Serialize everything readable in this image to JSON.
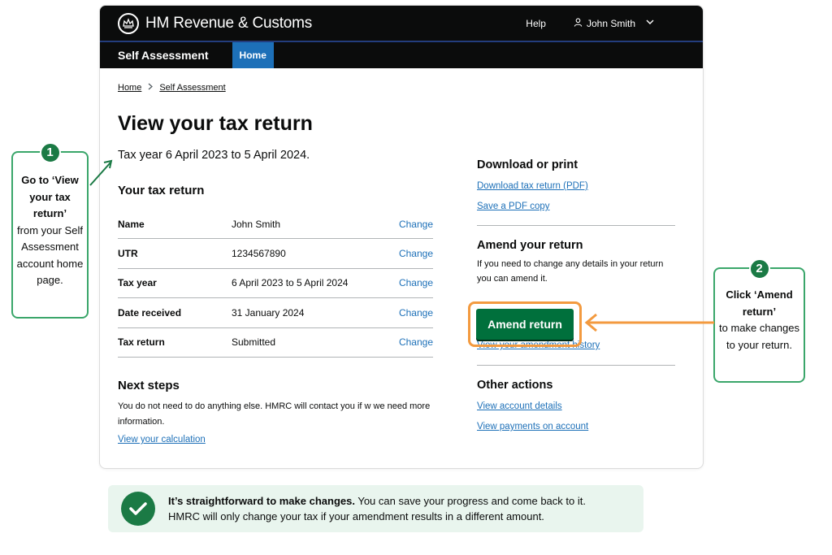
{
  "header": {
    "brand": "HM Revenue & Customs",
    "help": "Help",
    "user": "John Smith"
  },
  "service": {
    "name": "Self Assessment",
    "tab_home": "Home"
  },
  "breadcrumb": [
    "Home",
    "Self Assessment"
  ],
  "page": {
    "title": "View your tax return",
    "tax_year": "Tax year 6 April 2023 to 5 April 2024.",
    "section_title": "Your tax return",
    "change_label": "Change",
    "rows": [
      {
        "key": "Name",
        "value": "John Smith"
      },
      {
        "key": "UTR",
        "value": "1234567890"
      },
      {
        "key": "Tax year",
        "value": "6 April 2023 to 5 April 2024"
      },
      {
        "key": "Date received",
        "value": "31 January 2024"
      },
      {
        "key": "Tax return",
        "value": "Submitted"
      }
    ],
    "next_steps": {
      "title": "Next steps",
      "text": "You do not need to do anything else. HMRC will contact you if w we need more information.",
      "link": "View your calculation"
    }
  },
  "sidebar": {
    "download": {
      "title": "Download or print",
      "link1": "Download tax return (PDF)",
      "link2": "Save a PDF copy"
    },
    "amend": {
      "title": "Amend your return",
      "text": "If you need to change any details in your return you can amend it.",
      "button": "Amend return",
      "history": "View your amendment history"
    },
    "other": {
      "title": "Other actions",
      "link1": "View account details",
      "link2": "View payments on account"
    }
  },
  "callouts": {
    "one": {
      "number": "1",
      "bold": "Go to ‘View your tax return’",
      "rest": "from your Self Assessment account home page."
    },
    "two": {
      "number": "2",
      "bold": "Click ‘Amend return’",
      "rest": "to make changes to your return."
    }
  },
  "banner": {
    "bold": "It’s straightforward to make changes.",
    "text1": " You can save your progress and come back to it.",
    "text2": "HMRC will only change your tax if your amendment results in a different amount."
  },
  "colors": {
    "header_bg": "#0b0c0c",
    "link": "#1d70b8",
    "button_green": "#00703c",
    "callout_green": "#1b7a45",
    "highlight_orange": "#f39a3f",
    "banner_bg": "#e9f5ee"
  },
  "icons": [
    "crown-crest-icon",
    "user-icon",
    "chevron-down-icon",
    "chevron-right-icon",
    "checkmark-icon"
  ]
}
